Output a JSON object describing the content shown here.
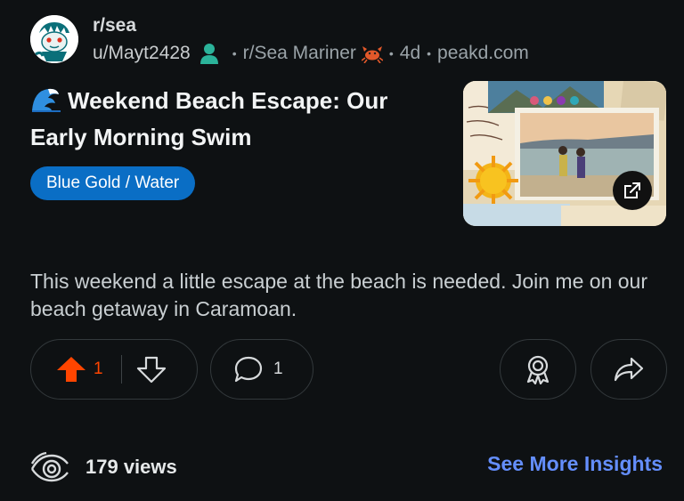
{
  "post": {
    "subreddit": "r/sea",
    "author": "u/Mayt2428",
    "crosspost": "r/Sea Mariner",
    "age": "4d",
    "domain": "peakd.com",
    "title_emoji": "wave-icon",
    "title": "Weekend Beach Escape: Our Early Morning Swim",
    "flair": "Blue Gold / Water",
    "body": "This weekend a little escape at the beach is needed. Join me on our beach getaway in Caramoan."
  },
  "actions": {
    "upvotes": "1",
    "comments": "1"
  },
  "footer": {
    "views": "179 views",
    "insights": "See More Insights"
  },
  "colors": {
    "background": "#0e1113",
    "flair": "#0a6ec5",
    "upvote": "#ff4500",
    "link": "#648efc",
    "user_icon": "#2bb39a"
  }
}
